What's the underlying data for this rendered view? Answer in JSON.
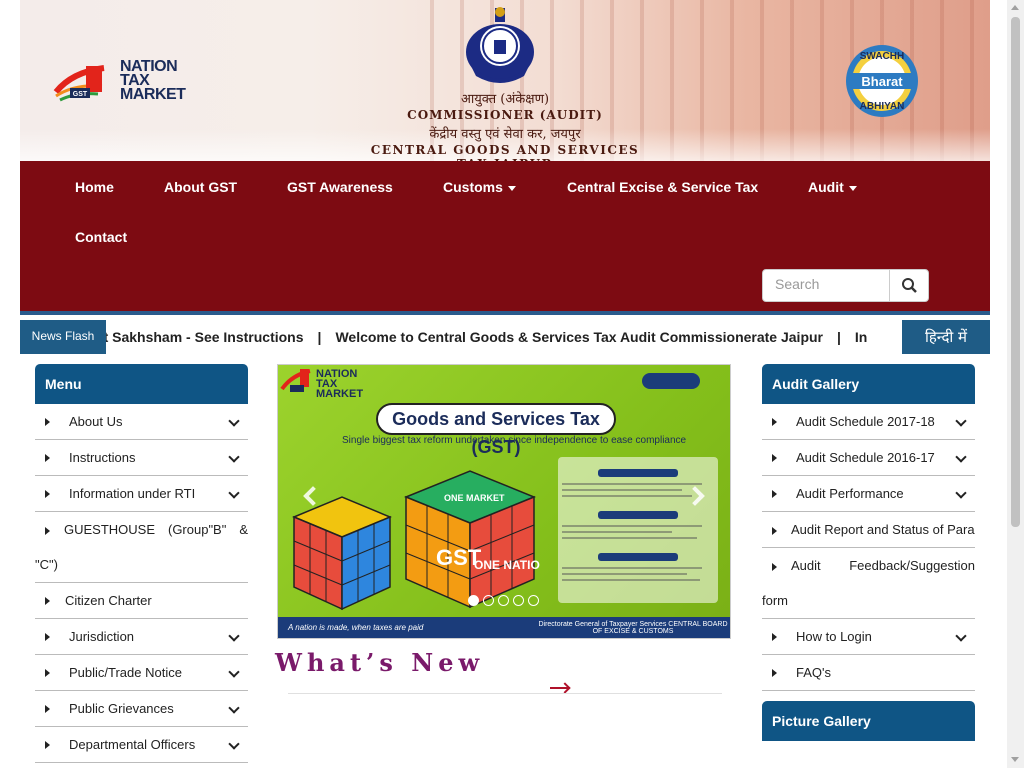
{
  "header": {
    "logo_text_line1": "NATION",
    "logo_text_line2": "TAX",
    "logo_text_line3": "MARKET",
    "logo_badge": "GST",
    "title_hindi_1": "आयुक्त (अंकेक्षण)",
    "title_english_1": "COMMISSIONER (AUDIT)",
    "title_hindi_2": "केंद्रीय वस्तु एवं सेवा कर, जयपुर",
    "title_english_2": "CENTRAL GOODS AND SERVICES TAX,JAIPUR",
    "swachh_text_1": "SWACHH",
    "swachh_text_2": "Bharat",
    "swachh_text_3": "ABHIYAN"
  },
  "nav": {
    "items": [
      {
        "label": "Home",
        "dropdown": false
      },
      {
        "label": "About GST",
        "dropdown": false
      },
      {
        "label": "GST Awareness",
        "dropdown": false
      },
      {
        "label": "Customs",
        "dropdown": true
      },
      {
        "label": "Central Excise & Service Tax",
        "dropdown": false
      },
      {
        "label": "Audit",
        "dropdown": true
      },
      {
        "label": "Contact",
        "dropdown": false
      }
    ],
    "search_placeholder": "Search",
    "search_icon": "search-icon"
  },
  "newsflash": {
    "label": "News Flash",
    "items": [
      "ect Sakhsham - See Instructions",
      "Welcome to Central Goods & Services Tax Audit Commissionerate Jaipur",
      "In"
    ],
    "separator": "|",
    "language_button": "हिन्दी में"
  },
  "left_menu": {
    "title": "Menu",
    "items": [
      {
        "label": "About Us",
        "expandable": true
      },
      {
        "label": "Instructions",
        "expandable": true
      },
      {
        "label": "Information under RTI",
        "expandable": true
      },
      {
        "label": "GUESTHOUSE (Group\"B\" & \"C\")",
        "expandable": false
      },
      {
        "label": "Citizen Charter",
        "expandable": false
      },
      {
        "label": "Jurisdiction",
        "expandable": true
      },
      {
        "label": "Public/Trade Notice",
        "expandable": true
      },
      {
        "label": "Public Grievances",
        "expandable": true
      },
      {
        "label": "Departmental Officers",
        "expandable": true
      }
    ]
  },
  "right_panel": {
    "gallery_title": "Audit Gallery",
    "items": [
      {
        "label": "Audit Schedule 2017-18",
        "expandable": true
      },
      {
        "label": "Audit Schedule 2016-17",
        "expandable": true
      },
      {
        "label": "Audit Performance",
        "expandable": true
      },
      {
        "label": "Audit Report and Status of Para",
        "expandable": false
      },
      {
        "label": "Audit Feedback/Suggestion form",
        "expandable": false
      },
      {
        "label": "How to Login",
        "expandable": true
      },
      {
        "label": "FAQ's",
        "expandable": false
      }
    ],
    "picture_gallery_title": "Picture Gallery"
  },
  "slider": {
    "logo_text": "NATION TAX MARKET",
    "title": "Goods and Services Tax (GST)",
    "subtitle": "Single biggest tax reform undertaken since independence to ease compliance",
    "footer_left": "A nation is made, when taxes are paid",
    "footer_middle": "Directorate General of Taxpayer Services CENTRAL BOARD OF EXCISE & CUSTOMS",
    "cube_text_1": "GST",
    "cube_text_2": "ONE NATION",
    "cube_text_3": "ONE MARKET",
    "dot_count": 5,
    "active_dot": 0
  },
  "whats_new": {
    "title": "What’s New"
  },
  "colors": {
    "nav_bg": "#7d0b12",
    "panel_head": "#0f5585",
    "news_label": "#1f5c86",
    "whats_new": "#7a1a6a"
  }
}
